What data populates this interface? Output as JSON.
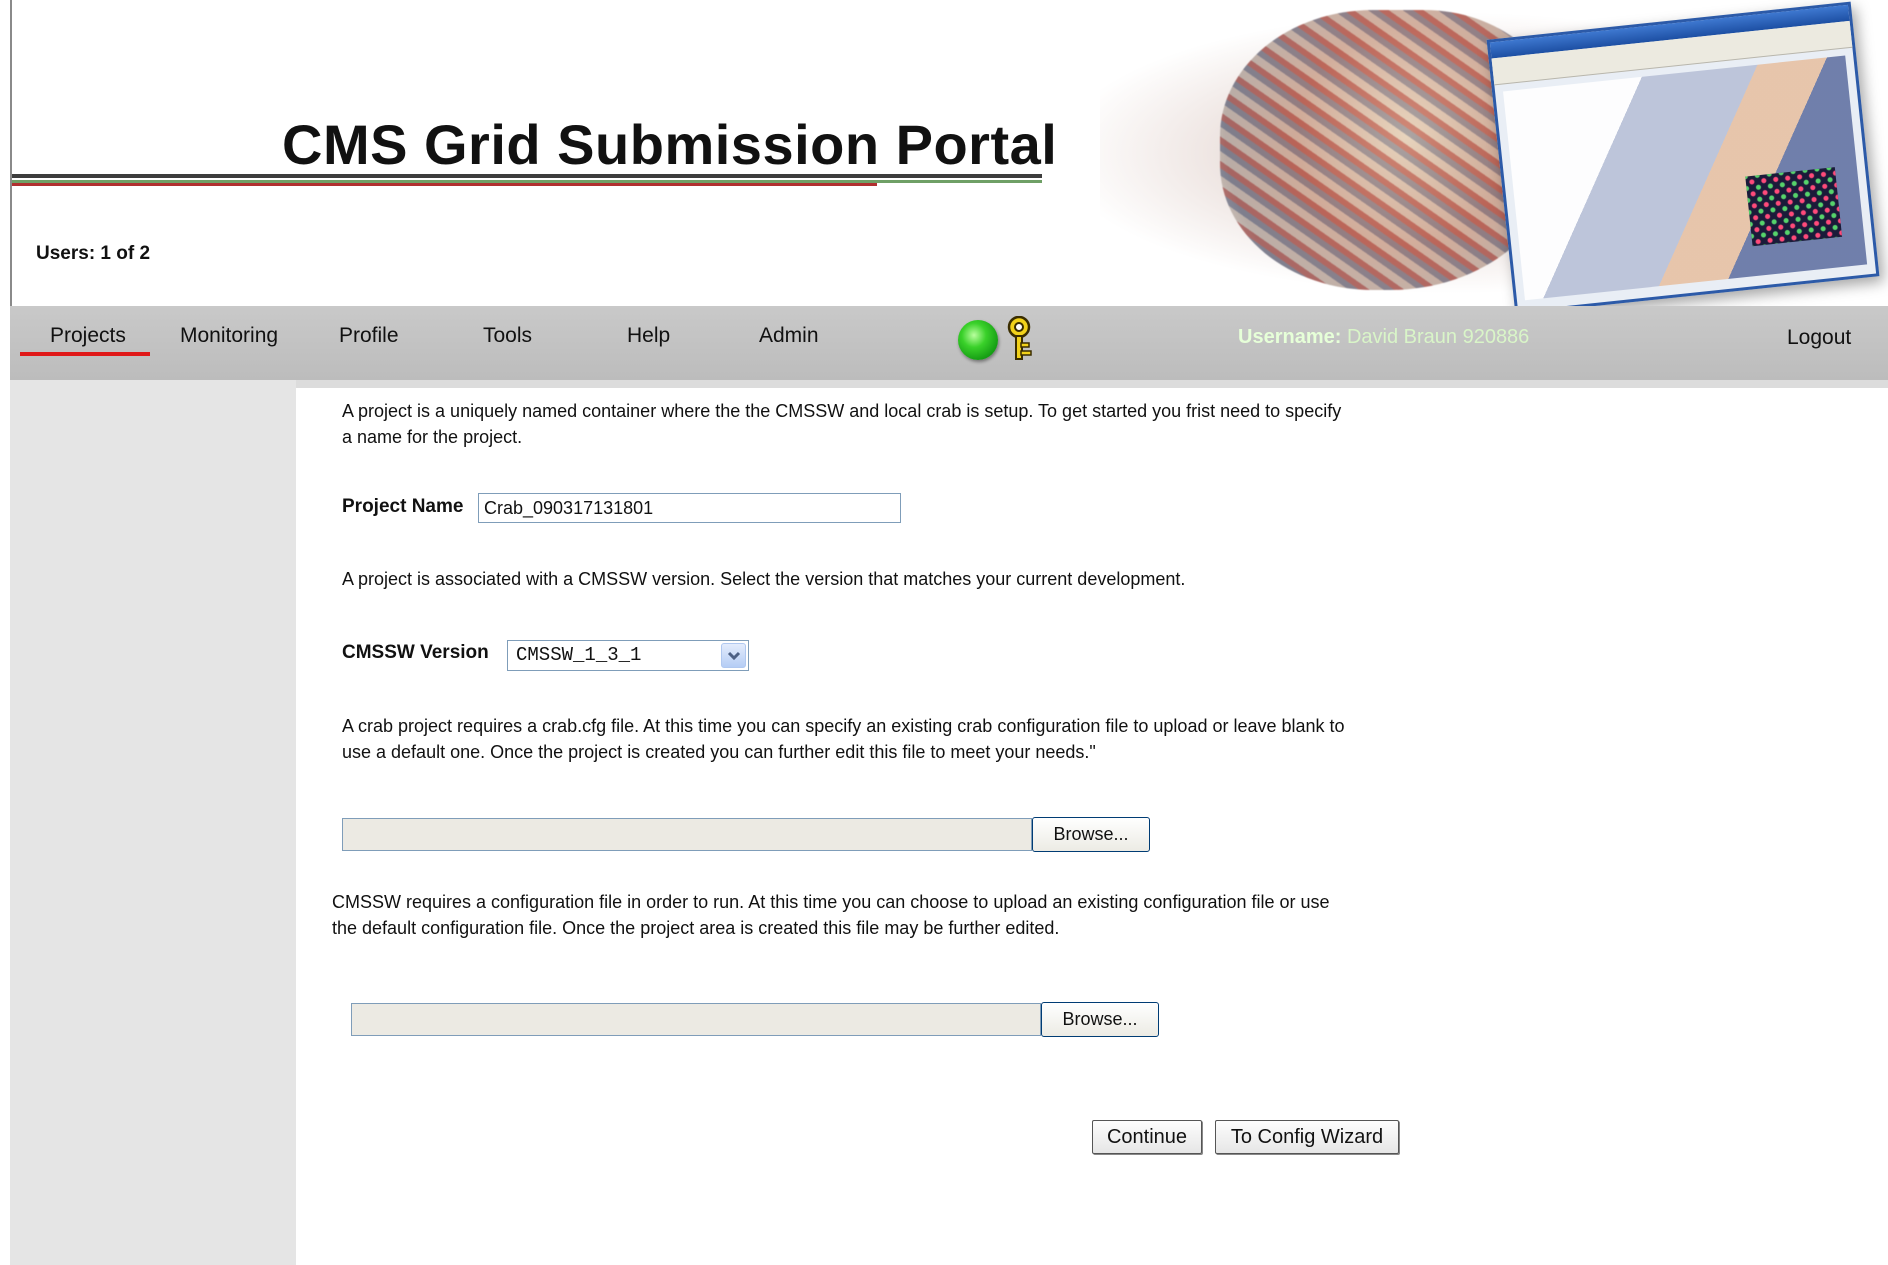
{
  "header": {
    "title": "CMS Grid Submission Portal",
    "users_count": "Users: 1 of 2"
  },
  "nav": {
    "items": [
      "Projects",
      "Monitoring",
      "Profile",
      "Tools",
      "Help",
      "Admin"
    ],
    "active": "Projects",
    "username_label": "Username:",
    "username_value": "David Braun 920886",
    "logout": "Logout",
    "status_light_color": "#2fc51f",
    "icons": [
      "status-light-icon",
      "key-icon"
    ]
  },
  "form": {
    "intro_text": "A project is a uniquely named container where the the CMSSW and local crab is setup. To get started you frist need to specify a name for the project.",
    "project_name_label": "Project Name",
    "project_name_value": "Crab_090317131801",
    "version_text": "A project is associated with a CMSSW version. Select the version that matches your current development.",
    "cmssw_version_label": "CMSSW Version",
    "cmssw_version_value": "CMSSW_1_3_1",
    "crab_text": "A crab project requires a crab.cfg file. At this time you can specify an existing crab configuration file to upload or leave blank to use a default one. Once the project is created you can further edit this file to meet your needs.\"",
    "crab_file_value": "",
    "browse_label": "Browse...",
    "cmssw_config_text": "CMSSW requires a configuration file in order to run. At this time you can choose to upload an existing configuration file or use the default configuration file. Once the project area is created this file may be further edited.",
    "cmssw_file_value": "",
    "continue_label": "Continue",
    "config_wizard_label": "To Config Wizard"
  }
}
